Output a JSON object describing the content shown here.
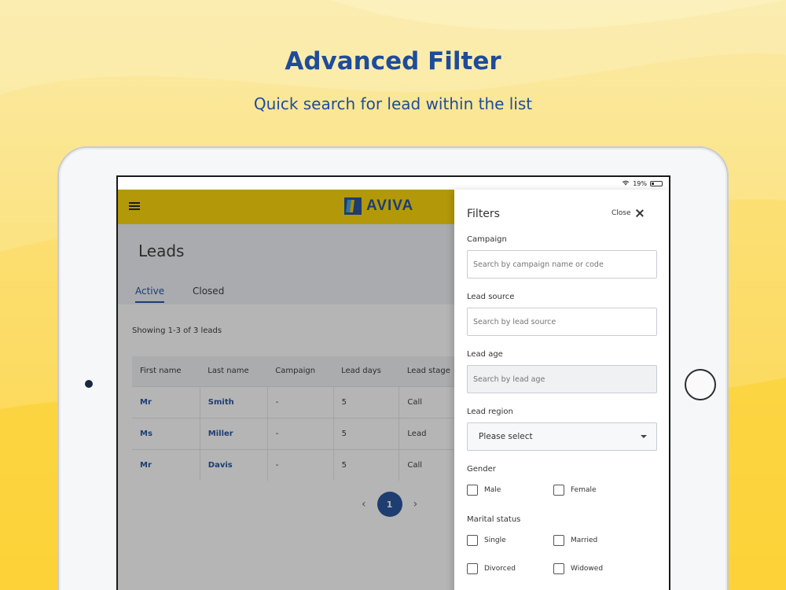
{
  "hero": {
    "title": "Advanced Filter",
    "subtitle": "Quick search for lead within the list"
  },
  "statusbar": {
    "battery": "19%"
  },
  "appbar": {
    "logo_text": "AVIVA"
  },
  "leads": {
    "title": "Leads",
    "tabs": [
      {
        "label": "Active"
      },
      {
        "label": "Closed"
      }
    ],
    "count_text": "Showing 1-3 of 3 leads",
    "columns": [
      "First name",
      "Last name",
      "Campaign",
      "Lead days",
      "Lead stage"
    ],
    "rows": [
      [
        "Mr",
        "Smith",
        "-",
        "5",
        "Call"
      ],
      [
        "Ms",
        "Miller",
        "-",
        "5",
        "Lead"
      ],
      [
        "Mr",
        "Davis",
        "-",
        "5",
        "Call"
      ]
    ],
    "pagination": {
      "current": "1"
    }
  },
  "filters": {
    "title": "Filters",
    "close_label": "Close",
    "campaign": {
      "label": "Campaign",
      "placeholder": "Search by campaign name or code"
    },
    "lead_source": {
      "label": "Lead source",
      "placeholder": "Search by lead source"
    },
    "lead_age": {
      "label": "Lead age",
      "placeholder": "Search by lead age"
    },
    "lead_region": {
      "label": "Lead region",
      "selected": "Please select"
    },
    "gender": {
      "label": "Gender",
      "options": [
        "Male",
        "Female"
      ]
    },
    "marital_status": {
      "label": "Marital status",
      "options": [
        "Single",
        "Married",
        "Divorced",
        "Widowed"
      ]
    }
  },
  "colors": {
    "brand_blue": "#1e4c9a",
    "brand_yellow": "#fdd600"
  }
}
